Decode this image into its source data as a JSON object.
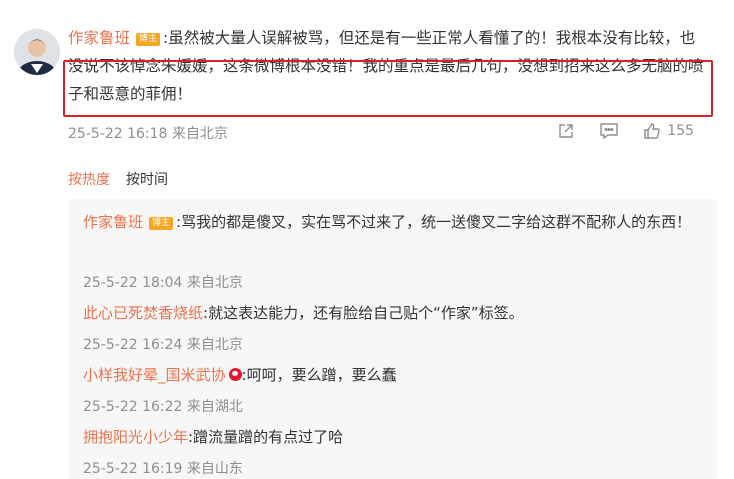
{
  "comment": {
    "username": "作家鲁班",
    "badge": "博主",
    "text": ":虽然被大量人误解被骂，但还是有一些正常人看懂了的！我根本没有比较，也没说不该悼念朱媛媛，这条微博根本没错！我的重点是最后几句，没想到招来这么多无脑的喷子和恶意的菲佣！",
    "timestamp": "25-5-22 16:18 来自北京",
    "like_count": "155",
    "highlight_color": "#d92027"
  },
  "sort": {
    "hot": "按热度",
    "time": "按时间"
  },
  "replies": [
    {
      "username": "作家鲁班",
      "badge": "博主",
      "text": ":骂我的都是傻叉，实在骂不过来了，统一送傻叉二字给这群不配称人的东西！",
      "timestamp": "25-5-22 18:04 来自北京"
    },
    {
      "username": "此心已死焚香烧纸",
      "text": ":就这表达能力，还有脸给自己贴个“作家”标签。",
      "timestamp": "25-5-22 16:24 来自北京"
    },
    {
      "username": "小样我好晕_国米武协",
      "icon": "weibo-verified-icon",
      "text": ":呵呵，要么蹭，要么蠢",
      "timestamp": "25-5-22 16:22 来自湖北"
    },
    {
      "username": "拥抱阳光小少年",
      "text": ":蹭流量蹭的有点过了哈",
      "timestamp": "25-5-22 16:19 来自山东"
    }
  ],
  "colors": {
    "username": "#eb7350",
    "meta": "#8f8f8f",
    "badge": "#f5a623",
    "reply_bg": "#f7f7f7"
  }
}
